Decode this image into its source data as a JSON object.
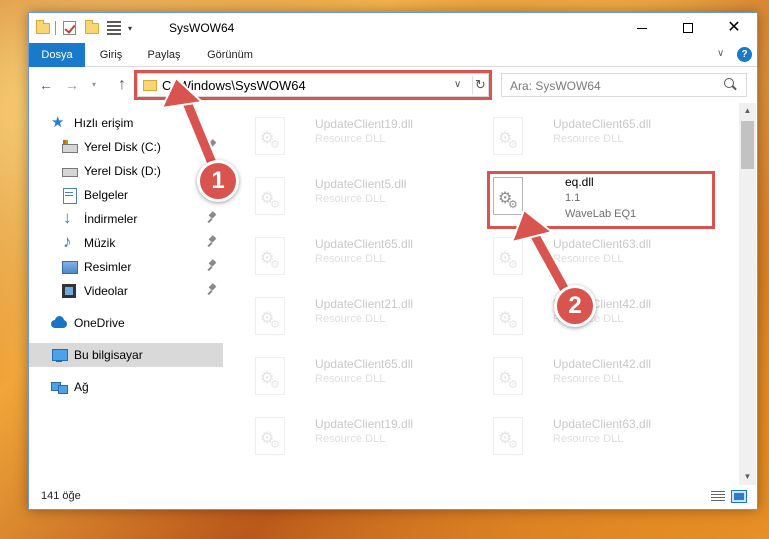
{
  "window": {
    "title": "SysWOW64",
    "controls": {
      "minimize": "minimize",
      "maximize": "maximize",
      "close": "✕"
    }
  },
  "ribbon": {
    "tabs": [
      "Dosya",
      "Giriş",
      "Paylaş",
      "Görünüm"
    ],
    "help": "?"
  },
  "address": {
    "path": "C:\\Windows\\SysWOW64",
    "search_placeholder": "Ara: SysWOW64"
  },
  "nav_pane": {
    "items": [
      {
        "label": "Hızlı erişim",
        "icon": "star-icon"
      },
      {
        "label": "Yerel Disk (C:)",
        "icon": "drive-icon",
        "pinned": true
      },
      {
        "label": "Yerel Disk (D:)",
        "icon": "drive-icon"
      },
      {
        "label": "Belgeler",
        "icon": "documents-icon"
      },
      {
        "label": "İndirmeler",
        "icon": "downloads-icon",
        "pinned": true
      },
      {
        "label": "Müzik",
        "icon": "music-icon",
        "pinned": true
      },
      {
        "label": "Resimler",
        "icon": "pictures-icon",
        "pinned": true
      },
      {
        "label": "Videolar",
        "icon": "videos-icon",
        "pinned": true
      },
      {
        "label": "OneDrive",
        "icon": "onedrive-icon"
      },
      {
        "label": "Bu bilgisayar",
        "icon": "this-pc-icon",
        "selected": true
      },
      {
        "label": "Ağ",
        "icon": "network-icon"
      }
    ]
  },
  "files": {
    "left_column": [
      {
        "name": "UpdateClient19.dll",
        "desc": "Resource DLL"
      },
      {
        "name": "UpdateClient5.dll",
        "desc": "Resource DLL"
      },
      {
        "name": "UpdateClient65.dll",
        "desc": "Resource DLL"
      },
      {
        "name": "UpdateClient21.dll",
        "desc": "Resource DLL"
      },
      {
        "name": "UpdateClient65.dll",
        "desc": "Resource DLL"
      },
      {
        "name": "UpdateClient19.dll",
        "desc": "Resource DLL"
      }
    ],
    "right_column": [
      {
        "name": "UpdateClient65.dll",
        "desc": "Resource DLL"
      },
      {
        "name": "eq.dll",
        "desc": "1.1",
        "desc2": "WaveLab EQ1",
        "highlighted": true
      },
      {
        "name": "UpdateClient63.dll",
        "desc": "Resource DLL"
      },
      {
        "name": "UpdateClient42.dll",
        "desc": "Resource DLL"
      },
      {
        "name": "UpdateClient42.dll",
        "desc": "Resource DLL"
      },
      {
        "name": "UpdateClient63.dll",
        "desc": "Resource DLL"
      }
    ]
  },
  "status": {
    "count": "141 öğe"
  },
  "callouts": {
    "step1": "1",
    "step2": "2",
    "color": "#d9534f"
  },
  "colors": {
    "accent": "#1979ca",
    "highlight": "#d9534f"
  }
}
